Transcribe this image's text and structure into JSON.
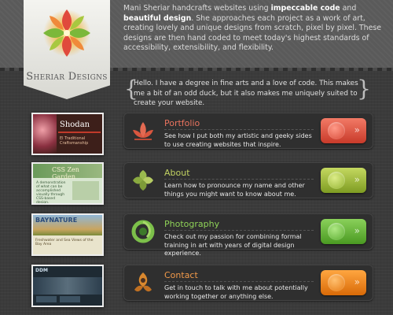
{
  "header": {
    "logo_text": "Sheriar Designs",
    "intro_pre": "Mani Sheriar handcrafts websites using ",
    "intro_b1": "impeccable code",
    "intro_mid": " and ",
    "intro_b2": "beautiful design",
    "intro_post": ". She approaches each project as a work of art, creating lovely and unique designs from scratch, pixel by pixel. These designs are then hand coded to meet today's highest standards of accessibility, extensibility, and flexibility."
  },
  "quote": {
    "open": "{",
    "close": "}",
    "text": "Hello. I have a degree in fine arts and a love of code. This makes me a bit of an odd duck, but it also makes me uniquely suited to create your website."
  },
  "thumbnails": [
    {
      "title": "Shodan",
      "subtitle": "El Traditional Craftsmanship"
    },
    {
      "title": "CSS Zen Garden",
      "subtitle": "A demonstration of what can be accomplished visually through CSS-based design."
    },
    {
      "title": "BAYNATURE",
      "subtitle": "Freshwater and Sea Views of the Bay Area"
    },
    {
      "title": "DDM"
    }
  ],
  "cards": [
    {
      "title": "Portfolio",
      "desc": "See how I put both my artistic and geeky sides to use creating websites that inspire.",
      "color": "#e06a55"
    },
    {
      "title": "About",
      "desc": "Learn how to pronounce my name and other things you might want to know about me.",
      "color": "#b7c85a"
    },
    {
      "title": "Photography",
      "desc": "Check out my passion for combining formal training in art with years of digital design experience.",
      "color": "#9ccf54"
    },
    {
      "title": "Contact",
      "desc": "Get in touch to talk with me about potentially working together or anything else.",
      "color": "#e8954a"
    }
  ],
  "colors": {
    "portfolio_btn": "#e55a4a",
    "about_btn": "#a6c23b",
    "photography_btn": "#6cbc3a",
    "contact_btn": "#f28a1c"
  },
  "icons": {
    "portfolio": "lotus-icon",
    "about": "leaf-cluster-icon",
    "photography": "swirl-icon",
    "contact": "ornament-icon",
    "button": "chevron-right-icon"
  }
}
